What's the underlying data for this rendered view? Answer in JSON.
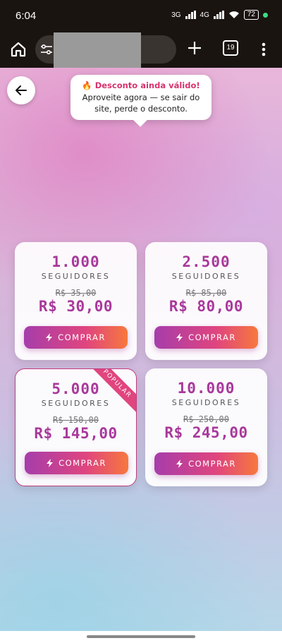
{
  "status_bar": {
    "time": "6:04",
    "network_1": "3G",
    "network_2": "4G",
    "battery": "72"
  },
  "browser": {
    "tab_count": "19",
    "icons": [
      "home-icon",
      "tune-icon",
      "plus-icon",
      "tabs-icon",
      "more-vert-icon"
    ]
  },
  "tooltip": {
    "title": "🔥 Desconto ainda válido!",
    "line1": "Aproveite agora — se sair do",
    "line2": "site, perde o desconto."
  },
  "plans": [
    {
      "quantity": "1.000",
      "unit": "SEGUIDORES",
      "old_price": "R$ 35,00",
      "new_price": "R$ 30,00",
      "button": "COMPRAR"
    },
    {
      "quantity": "2.500",
      "unit": "SEGUIDORES",
      "old_price": "R$ 85,00",
      "new_price": "R$ 80,00",
      "button": "COMPRAR"
    },
    {
      "quantity": "5.000",
      "unit": "SEGUIDORES",
      "old_price": "R$ 150,00",
      "new_price": "R$ 145,00",
      "button": "COMPRAR",
      "badge": "POPULAR"
    },
    {
      "quantity": "10.000",
      "unit": "SEGUIDORES",
      "old_price": "R$ 250,00",
      "new_price": "R$ 245,00",
      "button": "COMPRAR"
    }
  ],
  "colors": {
    "accent": "#a8399b",
    "badge": "#e0457e",
    "button_start": "#a63dab",
    "button_end": "#f7783d"
  }
}
